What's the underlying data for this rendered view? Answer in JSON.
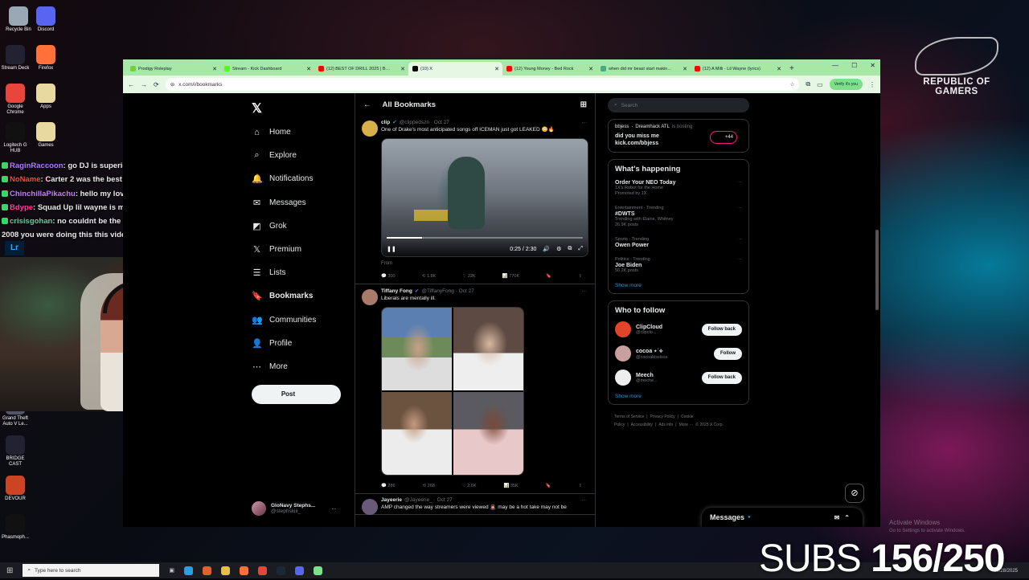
{
  "desktop": {
    "icons": [
      {
        "label": "Recycle Bin",
        "color": "#9aa7b5"
      },
      {
        "label": "Discord",
        "color": "#5865f2"
      },
      {
        "label": "Stream Deck",
        "color": "#223"
      },
      {
        "label": "Firefox",
        "color": "#ff7139"
      },
      {
        "label": "Google Chrome",
        "color": "#e8453c"
      },
      {
        "label": "Apps",
        "color": "#e8d9a0"
      },
      {
        "label": "Logitech G HUB",
        "color": "#111"
      },
      {
        "label": "Games",
        "color": "#e8d9a0"
      },
      {
        "label": "Grand Theft Auto V Le...",
        "color": "#556"
      },
      {
        "label": "BRIDGE CAST",
        "color": "#223"
      },
      {
        "label": "DEVOUR",
        "color": "#c42"
      },
      {
        "label": "Phasmoph...",
        "color": "#111"
      }
    ],
    "rog_text": "REPUBLIC OF GAMERS"
  },
  "chat": [
    {
      "user": "RaginRaccoon",
      "color": "#b07cff",
      "text": ": go DJ is superior"
    },
    {
      "user": "NoName",
      "color": "#ff4040",
      "text": ": Carter 2 was the best"
    },
    {
      "user": "ChinchillaPikachu",
      "color": "#c47cff",
      "text": ": hello my love"
    },
    {
      "user": "Bdype",
      "color": "#ff3aa0",
      "text": ": Squad Up lil wayne is my shit lol"
    },
    {
      "user": "crisisgohan",
      "color": "#48d8a0",
      "text": ": no couldnt be the video you said"
    },
    {
      "user": "",
      "color": "#fff",
      "text": "2008 you were doing this this video came out in 2012!"
    }
  ],
  "browser": {
    "tabs": [
      {
        "label": "Prodigy Roleplay",
        "color": "#7c4"
      },
      {
        "label": "Stream - Kick Dashboard",
        "color": "#53fc18"
      },
      {
        "label": "(12) BEST OF DRILL 2025 | BE...",
        "color": "#f00"
      },
      {
        "label": "(10) X",
        "color": "#000",
        "active": true
      },
      {
        "label": "(12) Young Money - Bed Rock",
        "color": "#f00"
      },
      {
        "label": "when did mr beast start makin...",
        "color": "#4a8"
      },
      {
        "label": "(12) A Milli - Lil Wayne (lyrics)",
        "color": "#f00"
      }
    ],
    "url": "x.com/i/bookmarks",
    "verify_label": "Verify it's you"
  },
  "x": {
    "nav": [
      {
        "icon": "⌂",
        "label": "Home",
        "name": "home"
      },
      {
        "icon": "⌕",
        "label": "Explore",
        "name": "explore"
      },
      {
        "icon": "🔔",
        "label": "Notifications",
        "name": "notifications"
      },
      {
        "icon": "✉",
        "label": "Messages",
        "name": "messages"
      },
      {
        "icon": "◩",
        "label": "Grok",
        "name": "grok"
      },
      {
        "icon": "𝕏",
        "label": "Premium",
        "name": "premium"
      },
      {
        "icon": "☰",
        "label": "Lists",
        "name": "lists"
      },
      {
        "icon": "🔖",
        "label": "Bookmarks",
        "name": "bookmarks",
        "bold": true
      },
      {
        "icon": "👥",
        "label": "Communities",
        "name": "communities"
      },
      {
        "icon": "👤",
        "label": "Profile",
        "name": "profile"
      },
      {
        "icon": "⋯",
        "label": "More",
        "name": "more"
      }
    ],
    "post_label": "Post",
    "account": {
      "name": "GloNavy Stephs...",
      "handle": "@stephskiii_"
    },
    "header": "All Bookmarks",
    "tweets": [
      {
        "name": "clip",
        "handle": "@clippedszn · Oct 27",
        "text": "One of Drake's most anticipated songs off ICEMAN just got LEAKED 😳🔥",
        "time": "0:25 / 2:30",
        "from": "From",
        "stats": {
          "replies": "300",
          "reposts": "1.8K",
          "likes": "22K",
          "views": "770K"
        }
      },
      {
        "name": "Tiffany Fong",
        "handle": "@TiffanyFong · Oct 27",
        "text": "Liberals are mentally ill.",
        "stats": {
          "replies": "286",
          "reposts": "268",
          "likes": "2.6K",
          "views": "35K"
        }
      },
      {
        "name": "Jayeerie",
        "handle": "@Jayeerie_ · Oct 27",
        "text": "AMP changed the way streamers were viewed 🙇‍♀️ may be a hot take may not be"
      }
    ],
    "search_placeholder": "Search",
    "live": {
      "user": "bbjess",
      "title": "Dreamhack ATL",
      "status": "is hosting",
      "line1": "did you miss me",
      "line2": "kick.com/bbjess",
      "count": "+44"
    },
    "happening": {
      "title": "What's happening",
      "trends": [
        {
          "meta": "",
          "title": "Order Your NEO Today",
          "sub": "1X's Robot for the Home",
          "extra": "Promoted by 1X"
        },
        {
          "meta": "Entertainment · Trending",
          "title": "#DWTS",
          "sub": "Trending with Elaine, Whitney",
          "extra": "26.9K posts"
        },
        {
          "meta": "Sports · Trending",
          "title": "Owen Power",
          "sub": "",
          "extra": ""
        },
        {
          "meta": "Politics · Trending",
          "title": "Joe Biden",
          "sub": "",
          "extra": "56.2K posts"
        }
      ],
      "show_more": "Show more"
    },
    "who_to_follow": {
      "title": "Who to follow",
      "people": [
        {
          "name": "ClipCloud",
          "handle": "@clipclo...",
          "button": "Follow back",
          "color": "#e0452a"
        },
        {
          "name": "cocoa ⋆˙⟡",
          "handle": "@cocoakissless",
          "button": "Follow",
          "color": "#c9a0a0"
        },
        {
          "name": "Meech",
          "handle": "@meche...",
          "button": "Follow back",
          "color": "#eee"
        }
      ],
      "show_more": "Show more"
    },
    "footer": [
      "Terms of Service",
      "|",
      "Privacy Policy",
      "|",
      "Cookie Policy",
      "|",
      "Accessibility",
      "|",
      "Ads info",
      "|",
      "More ···",
      "© 2025 X Corp."
    ],
    "messages_label": "Messages"
  },
  "taskbar": {
    "search_placeholder": "Type here to search",
    "date": "10/28/2025"
  },
  "overlay": {
    "subs_label": "SUBS",
    "subs_count": "156/250",
    "activate": "Activate Windows",
    "activate_sub": "Go to Settings to activate Windows."
  }
}
